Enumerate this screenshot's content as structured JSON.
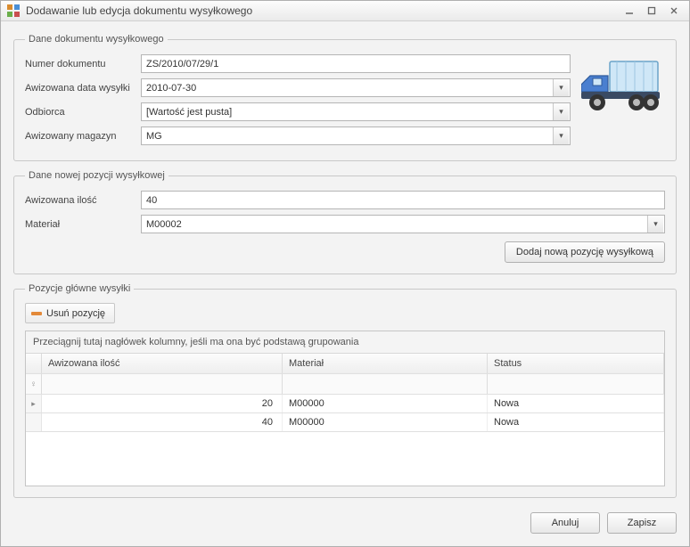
{
  "window": {
    "title": "Dodawanie lub edycja dokumentu wysyłkowego"
  },
  "group_doc": {
    "legend": "Dane dokumentu wysyłkowego",
    "labels": {
      "number": "Numer dokumentu",
      "advised_date": "Awizowana data wysyłki",
      "recipient": "Odbiorca",
      "warehouse": "Awizowany magazyn"
    },
    "values": {
      "number": "ZS/2010/07/29/1",
      "advised_date": "2010-07-30",
      "recipient": "[Wartość jest pusta]",
      "warehouse": "MG"
    }
  },
  "group_new_pos": {
    "legend": "Dane nowej pozycji wysyłkowej",
    "labels": {
      "qty": "Awizowana ilość",
      "material": "Materiał"
    },
    "values": {
      "qty": "40",
      "material": "M00002"
    },
    "add_button": "Dodaj nową pozycję wysyłkową"
  },
  "group_positions": {
    "legend": "Pozycje główne wysyłki",
    "delete_button": "Usuń pozycję",
    "group_hint": "Przeciągnij tutaj nagłówek kolumny, jeśli ma ona być podstawą grupowania",
    "columns": {
      "qty": "Awizowana ilość",
      "material": "Materiał",
      "status": "Status"
    },
    "rows": [
      {
        "qty": "20",
        "material": "M00000",
        "status": "Nowa"
      },
      {
        "qty": "40",
        "material": "M00000",
        "status": "Nowa"
      }
    ]
  },
  "footer": {
    "cancel": "Anuluj",
    "save": "Zapisz"
  }
}
